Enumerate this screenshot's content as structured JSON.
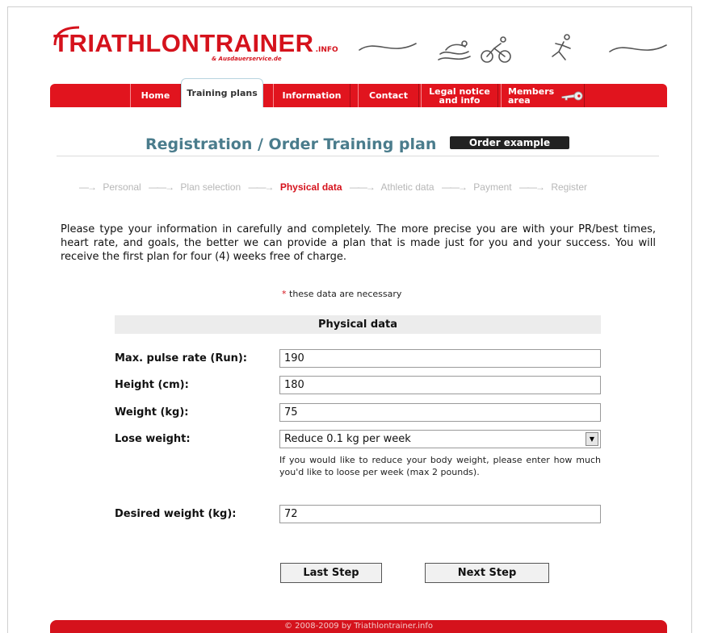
{
  "logo": {
    "name": "TRIATHLONTRAINER",
    "suffix": ".INFO",
    "sub": "& Ausdauerservice.de",
    "sport_icons": "swim-bike-run-icons"
  },
  "nav": {
    "home": "Home",
    "training_plans": "Training plans",
    "information": "Information",
    "contact": "Contact",
    "legal_line1": "Legal notice",
    "legal_line2": "and info",
    "members_line1": "Members",
    "members_line2": "area",
    "members_icon": "key-icon",
    "active": "Training plans"
  },
  "page": {
    "title": "Registration / Order Training plan",
    "order_example": "Order example"
  },
  "steps": {
    "items": [
      "Personal",
      "Plan selection",
      "Physical data",
      "Athletic data",
      "Payment",
      "Register"
    ],
    "current": "Physical data"
  },
  "intro": "Please type your information in carefully and completely. The more precise you are with your PR/best times, heart rate, and goals, the better we can provide a plan that is made just for you and your success. You will receive the first plan for four (4) weeks free of charge.",
  "required": {
    "star": "*",
    "text": "these data are necessary"
  },
  "form": {
    "section_title": "Physical data",
    "max_pulse_label": "Max. pulse rate (Run):",
    "max_pulse_value": "190",
    "height_label": "Height (cm):",
    "height_value": "180",
    "weight_label": "Weight (kg):",
    "weight_value": "75",
    "lose_weight_label": "Lose weight:",
    "lose_weight_value": "Reduce 0.1 kg per week",
    "lose_weight_help": "If you would like to reduce your body weight, please enter how much you'd like to loose per week (max 2 pounds).",
    "desired_weight_label": "Desired weight (kg):",
    "desired_weight_value": "72"
  },
  "buttons": {
    "last_step": "Last Step",
    "next_step": "Next Step"
  },
  "footer": "© 2008-2009 by Triathlontrainer.info",
  "colors": {
    "brand_red": "#d5121c",
    "title_teal": "#4a7c8c",
    "step_inactive": "#b7b7b7"
  }
}
